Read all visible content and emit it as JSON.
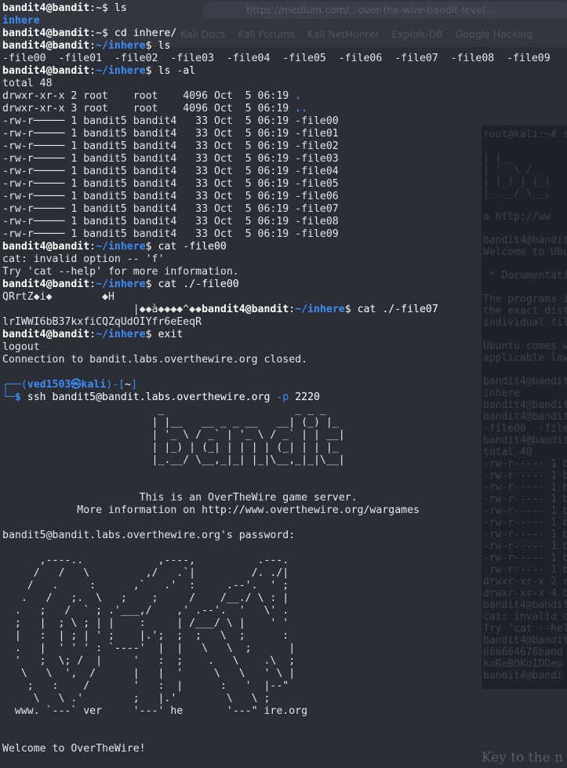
{
  "background": {
    "url_text": "https://medium.com/...over-the-wire-bandit-level...",
    "bookmarks": [
      "Kali Docs",
      "Kali Forums",
      "Kali NetHunter",
      "Exploit-DB",
      "Google Hacking"
    ],
    "second_terminal": "root@kali:~# s\n\n| |__\n| '_ \\ / _\n| |_) | (_|\n|_.__/ \\__,\n\na http://ww\n\nbandit4@bandit\nWelcome to Ubu\n\n * Documentati\n\nThe programs i\nthe exact dist\nindividual fil\n\nUbuntu comes w\napplicable law\n\nbandit4@bandit\ninhere\nbandit4@bandit\nbandit4@bandit\n-file00  -file\nbandit4@bandit\ntotal 48\n-rw-r----- 1 b\n-rw-r----- 1 b\n-rw-r----- 1 b\n-rw-r----- 1 b\n-rw-r----- 1 b\n-rw-r----- 1 b\n-rw-r----- 1 b\n-rw-r----- 1 b\n-rw-r----- 1 b\n-rw-r----- 1 b\ndrwxr-xr-x 2 r\ndrwxr-xr-x 4 b\nbandit4@bandit\ncat: invalid o\nTry 'cat --hel\nbandit4@bandit\n666664676band\nkoReBOKuIDDep\nbandit4@bandi",
    "article_heading": "Key to the n"
  },
  "terminal": {
    "lines": [
      [
        {
          "c": "u",
          "t": "bandit4@bandit"
        },
        {
          "c": "w",
          "t": ":~$ ls"
        }
      ],
      [
        {
          "c": "d",
          "t": "inhere"
        }
      ],
      [
        {
          "c": "u",
          "t": "bandit4@bandit"
        },
        {
          "c": "w",
          "t": ":~$ cd inhere/"
        }
      ],
      [
        {
          "c": "u",
          "t": "bandit4@bandit"
        },
        {
          "c": "w",
          "t": ":"
        },
        {
          "c": "b",
          "t": "~/inhere"
        },
        {
          "c": "w",
          "t": "$ ls"
        }
      ],
      [
        {
          "c": "",
          "t": "-file00  -file01  -file02  -file03  -file04  -file05  -file06  -file07  -file08  -file09"
        }
      ],
      [
        {
          "c": "u",
          "t": "bandit4@bandit"
        },
        {
          "c": "w",
          "t": ":"
        },
        {
          "c": "b",
          "t": "~/inhere"
        },
        {
          "c": "w",
          "t": "$ ls -al"
        }
      ],
      [
        {
          "c": "",
          "t": "total 48"
        }
      ],
      [
        {
          "c": "",
          "t": "drwxr-xr-x 2 root    root    4096 Oct  5 06:19 "
        },
        {
          "c": "d",
          "t": "."
        }
      ],
      [
        {
          "c": "",
          "t": "drwxr-xr-x 3 root    root    4096 Oct  5 06:19 "
        },
        {
          "c": "d",
          "t": ".."
        }
      ],
      [
        {
          "c": "",
          "t": "-rw-r───── 1 bandit5 bandit4   33 Oct  5 06:19 -file00"
        }
      ],
      [
        {
          "c": "",
          "t": "-rw-r───── 1 bandit5 bandit4   33 Oct  5 06:19 -file01"
        }
      ],
      [
        {
          "c": "",
          "t": "-rw-r───── 1 bandit5 bandit4   33 Oct  5 06:19 -file02"
        }
      ],
      [
        {
          "c": "",
          "t": "-rw-r───── 1 bandit5 bandit4   33 Oct  5 06:19 -file03"
        }
      ],
      [
        {
          "c": "",
          "t": "-rw-r───── 1 bandit5 bandit4   33 Oct  5 06:19 -file04"
        }
      ],
      [
        {
          "c": "",
          "t": "-rw-r───── 1 bandit5 bandit4   33 Oct  5 06:19 -file05"
        }
      ],
      [
        {
          "c": "",
          "t": "-rw-r───── 1 bandit5 bandit4   33 Oct  5 06:19 -file06"
        }
      ],
      [
        {
          "c": "",
          "t": "-rw-r───── 1 bandit5 bandit4   33 Oct  5 06:19 -file07"
        }
      ],
      [
        {
          "c": "",
          "t": "-rw-r───── 1 bandit5 bandit4   33 Oct  5 06:19 -file08"
        }
      ],
      [
        {
          "c": "",
          "t": "-rw-r───── 1 bandit5 bandit4   33 Oct  5 06:19 -file09"
        }
      ],
      [
        {
          "c": "u",
          "t": "bandit4@bandit"
        },
        {
          "c": "w",
          "t": ":"
        },
        {
          "c": "b",
          "t": "~/inhere"
        },
        {
          "c": "w",
          "t": "$ cat -file00"
        }
      ],
      [
        {
          "c": "",
          "t": "cat: invalid option -- 'f'"
        }
      ],
      [
        {
          "c": "",
          "t": "Try 'cat --help' for more information."
        }
      ],
      [
        {
          "c": "u",
          "t": "bandit4@bandit"
        },
        {
          "c": "w",
          "t": ":"
        },
        {
          "c": "b",
          "t": "~/inhere"
        },
        {
          "c": "w",
          "t": "$ cat ./-file00"
        }
      ],
      [
        {
          "c": "",
          "t": "QRrtZ◆i◆        ◆H"
        }
      ],
      [
        {
          "c": "",
          "t": "                     |◆◆à◆◆◆◆^◆◆"
        },
        {
          "c": "u",
          "t": "bandit4@bandit"
        },
        {
          "c": "w",
          "t": ":"
        },
        {
          "c": "b",
          "t": "~/inhere"
        },
        {
          "c": "w",
          "t": "$ cat ./-file07"
        }
      ],
      [
        {
          "c": "",
          "t": "lrIWWI6bB37kxfiCQZqUdOIYfr6eEeqR"
        }
      ],
      [
        {
          "c": "u",
          "t": "bandit4@bandit"
        },
        {
          "c": "w",
          "t": ":"
        },
        {
          "c": "b",
          "t": "~/inhere"
        },
        {
          "c": "w",
          "t": "$ exit"
        }
      ],
      [
        {
          "c": "",
          "t": "logout"
        }
      ],
      [
        {
          "c": "",
          "t": "Connection to bandit.labs.overthewire.org closed."
        }
      ],
      [
        {
          "c": "",
          "t": ""
        }
      ],
      [
        {
          "c": "g",
          "t": "┌──("
        },
        {
          "c": "b",
          "t": "ved1503㉿kali"
        },
        {
          "c": "g",
          "t": ")-["
        },
        {
          "c": "w",
          "t": "~"
        },
        {
          "c": "g",
          "t": "]"
        }
      ],
      [
        {
          "c": "g",
          "t": "└─"
        },
        {
          "c": "b",
          "t": "$"
        },
        {
          "c": "w",
          "t": " ssh bandit5@bandit.labs.overthewire.org "
        },
        {
          "c": "p",
          "t": "-p"
        },
        {
          "c": "w",
          "t": " 2220"
        }
      ],
      [
        {
          "c": "ascii",
          "t": "                         _                     _ _ _"
        }
      ],
      [
        {
          "c": "ascii",
          "t": "                        | |__   __ _ _ __   __| (_) |_"
        }
      ],
      [
        {
          "c": "ascii",
          "t": "                        | '_ \\ / _` | '_ \\ / _` | | __|"
        }
      ],
      [
        {
          "c": "ascii",
          "t": "                        | |_) | (_| | | | | (_| | | |_"
        }
      ],
      [
        {
          "c": "ascii",
          "t": "                        |_.__/ \\__,_|_| |_|\\__,_|_|\\__|"
        }
      ],
      [
        {
          "c": "",
          "t": ""
        }
      ],
      [
        {
          "c": "",
          "t": ""
        }
      ],
      [
        {
          "c": "",
          "t": "                      This is an OverTheWire game server."
        }
      ],
      [
        {
          "c": "",
          "t": "            More information on http://www.overthewire.org/wargames"
        }
      ],
      [
        {
          "c": "",
          "t": ""
        }
      ],
      [
        {
          "c": "",
          "t": "bandit5@bandit.labs.overthewire.org's password:"
        }
      ],
      [
        {
          "c": "",
          "t": ""
        }
      ],
      [
        {
          "c": "ascii",
          "t": "      ,----..            ,----,          .---."
        }
      ],
      [
        {
          "c": "ascii",
          "t": "     /   /   \\         ,/   .`|         /. ./|"
        }
      ],
      [
        {
          "c": "ascii",
          "t": "    /   .     :      ,`   .'  :     .--'.  ' ;"
        }
      ],
      [
        {
          "c": "ascii",
          "t": "   .   /   ;.  \\   ;    ;     /    /__./ \\ : |"
        }
      ],
      [
        {
          "c": "ascii",
          "t": "  .   ;   /  ` ; .'___,/    ,' .--'.  '   \\' ."
        }
      ],
      [
        {
          "c": "ascii",
          "t": "  ;   |  ; \\ ; | |    :     | /___/ \\ |    ' '"
        }
      ],
      [
        {
          "c": "ascii",
          "t": "  |   :  | ; | ' ;    |.';  ;  ;   \\  ;      :"
        }
      ],
      [
        {
          "c": "ascii",
          "t": "  .   |  ' ' ' : `----'  |  |   \\   \\  ;      |"
        }
      ],
      [
        {
          "c": "ascii",
          "t": "  '   ;  \\; /  |     '   :  ;    .   \\    .\\  ;"
        }
      ],
      [
        {
          "c": "ascii",
          "t": "   \\   \\  ',  /      |   |  '     \\   \\   ' \\ |"
        }
      ],
      [
        {
          "c": "ascii",
          "t": "    ;   :    /       '   :  |      :   '  |--\""
        }
      ],
      [
        {
          "c": "ascii",
          "t": "     \\   \\ .'        ;   |.'        \\   \\ ;"
        }
      ],
      [
        {
          "c": "ascii",
          "t": "  www. `---` ver     '---' he       '---\" ire.org"
        }
      ],
      [
        {
          "c": "",
          "t": ""
        }
      ],
      [
        {
          "c": "",
          "t": ""
        }
      ],
      [
        {
          "c": "",
          "t": "Welcome to OverTheWire!"
        }
      ]
    ]
  }
}
